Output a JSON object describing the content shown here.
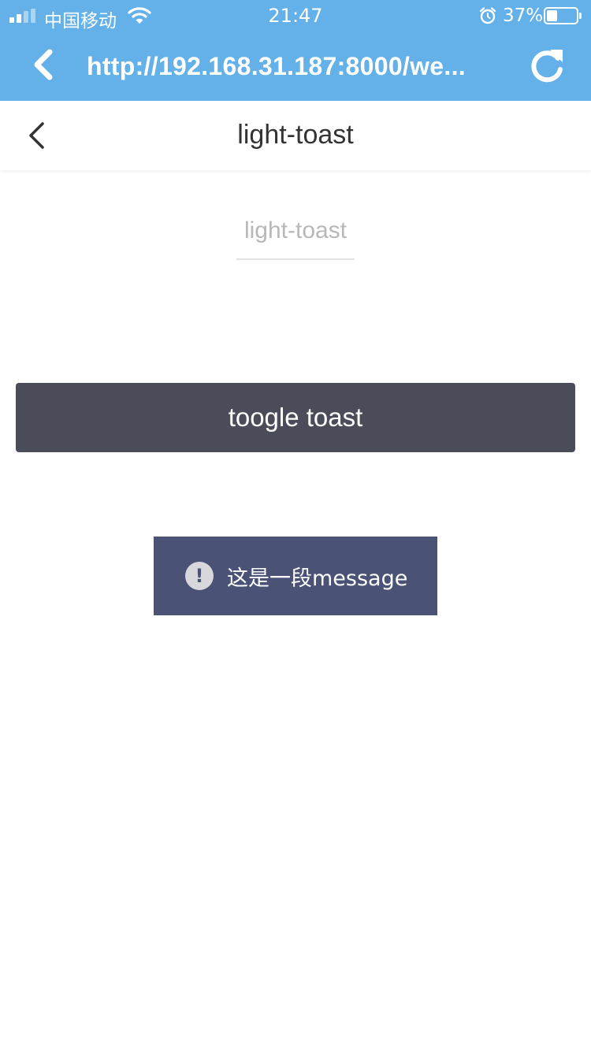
{
  "status_bar": {
    "carrier": "中国移动",
    "time": "21:47",
    "battery_percent_label": "37%",
    "battery_level": 0.37,
    "signal_bars_filled": 2,
    "icons": [
      "signal-icon",
      "wifi-icon",
      "alarm-icon",
      "battery-icon"
    ]
  },
  "browser": {
    "url": "http://192.168.31.187:8000/we...",
    "back_icon": "chevron-left-icon",
    "refresh_icon": "refresh-icon"
  },
  "navbar": {
    "title": "light-toast",
    "back_icon": "chevron-left-icon"
  },
  "content": {
    "subtitle": "light-toast",
    "toggle_button_label": "toogle toast"
  },
  "toast": {
    "icon": "exclamation-icon",
    "icon_glyph": "!",
    "message": "这是一段message"
  },
  "colors": {
    "browser_bar": "#63b1e8",
    "button": "#4a4c59",
    "toast": "#4a5275"
  }
}
